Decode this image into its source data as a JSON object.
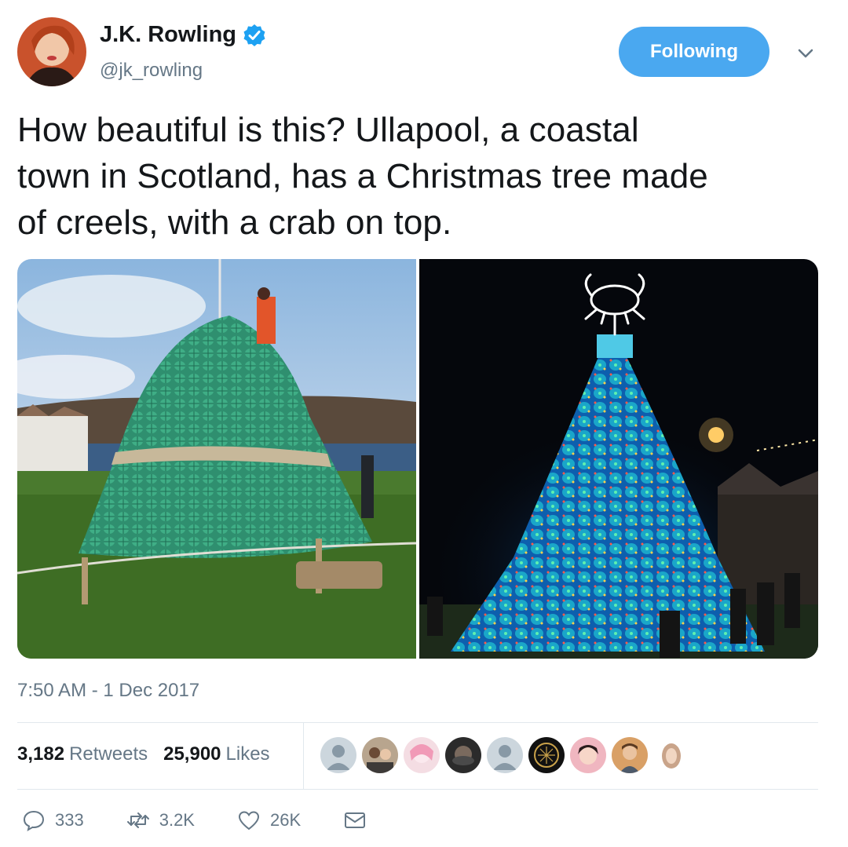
{
  "user": {
    "name": "J.K. Rowling",
    "handle": "@jk_rowling",
    "follow_label": "Following"
  },
  "tweet": {
    "text_lines": [
      "How beautiful is this? Ullapool, a coastal",
      "town in Scotland, has a Christmas tree made",
      "of creels, with a crab on top."
    ],
    "timestamp": "7:50 AM - 1 Dec 2017"
  },
  "stats": {
    "retweets_count": "3,182",
    "retweets_label": "Retweets",
    "likes_count": "25,900",
    "likes_label": "Likes"
  },
  "actions": {
    "replies": "333",
    "retweets": "3.2K",
    "likes": "26K"
  },
  "colors": {
    "accent": "#4aa8f0",
    "verified": "#1da1f2",
    "secondary_text": "#657786"
  }
}
